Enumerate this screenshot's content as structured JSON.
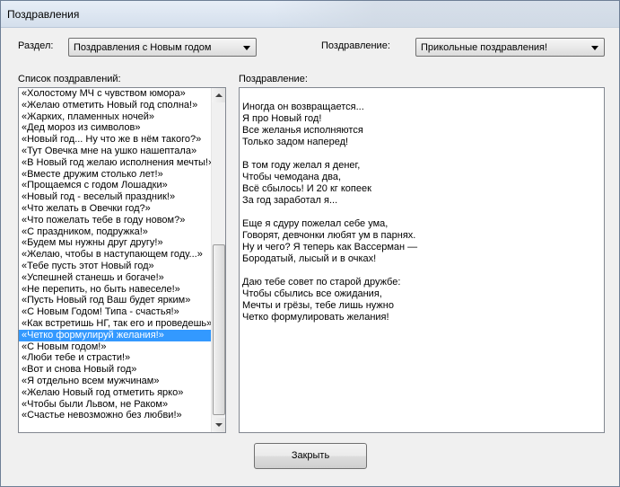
{
  "window": {
    "title": "Поздравления"
  },
  "section": {
    "label": "Раздел:",
    "value": "Поздравления с Новым годом"
  },
  "greeting_type": {
    "label": "Поздравление:",
    "value": "Прикольные поздравления!"
  },
  "list": {
    "label": "Список поздравлений:",
    "selected_index": 21,
    "items": [
      "«Холостому МЧ с чувством юмора»",
      "«Желаю отметить Новый год сполна!»",
      "«Жарких, пламенных ночей»",
      "«Дед мороз из символов»",
      "«Новый год... Ну что же в нём такого?»",
      "«Тут Овечка мне на ушко нашептала»",
      "«В Новый год желаю исполнения мечты!»",
      "«Вместе дружим столько лет!»",
      "«Прощаемся с годом Лошадки»",
      "«Новый год - веселый праздник!»",
      "«Что желать в Овечки год?»",
      "«Что пожелать тебе в году новом?»",
      "«С праздником, подружка!»",
      "«Будем мы нужны друг другу!»",
      "«Желаю, чтобы в наступающем году...»",
      "«Тебе пусть этот Новый год»",
      "«Успешней станешь и богаче!»",
      "«Не перепить, но быть навеселе!»",
      "«Пусть Новый год Ваш будет ярким»",
      "«С Новым Годом! Типа - счастья!»",
      "«Как встретишь НГ, так его и проведешь»",
      "«Четко формулируй желания!»",
      "«С Новым годом!»",
      " «Люби тебе и страсти!»",
      "«Вот и снова Новый год»",
      "«Я отдельно всем мужчинам»",
      "«Желаю Новый год отметить ярко»",
      "«Чтобы были Львом, не Раком»",
      "«Счастье невозможно без любви!»"
    ]
  },
  "greeting": {
    "label": "Поздравление:",
    "lines": [
      "Иногда он возвращается...",
      "Я про Новый год!",
      "Все желанья исполняются",
      "Только задом наперед!",
      "",
      "В том году желал я денег,",
      "Чтобы чемодана два,",
      "Всё сбылось! И 20 кг копеек",
      "За год заработал я...",
      "",
      "Еще я сдуру пожелал себе ума,",
      "Говорят, девчонки любят ум в парнях.",
      "Ну и чего? Я теперь как Вассерман —",
      "Бородатый, лысый и в очках!",
      "",
      "Даю тебе совет по старой дружбе:",
      "Чтобы сбылись все ожидания,",
      "Мечты и грёзы, тебе лишь нужно",
      "Четко формулировать желания!"
    ]
  },
  "close_button": {
    "label": "Закрыть"
  }
}
